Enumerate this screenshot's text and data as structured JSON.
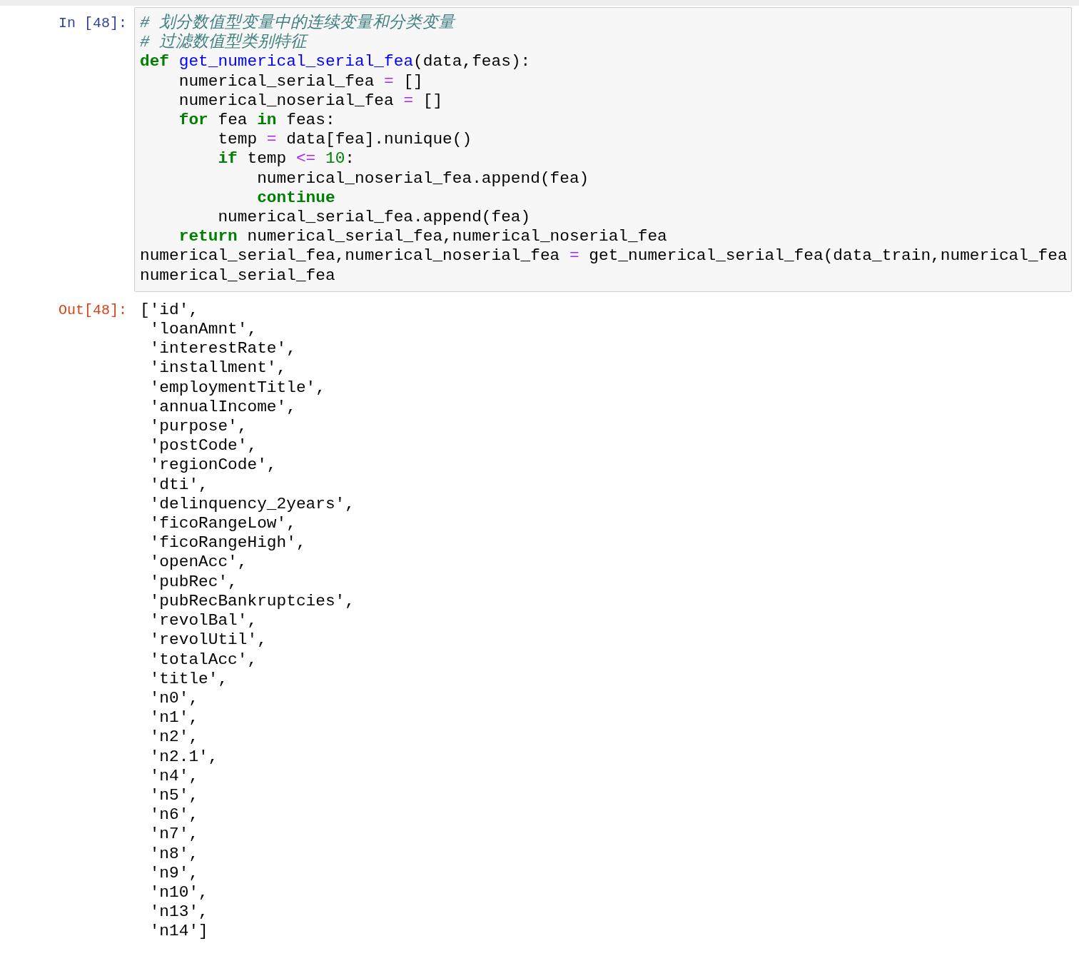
{
  "input_cell": {
    "prompt": "In [48]:",
    "lines": [
      [
        {
          "text": "# 划分数值型变量中的连续变量和分类变量",
          "kind": "comment"
        }
      ],
      [
        {
          "text": "# 过滤数值型类别特征",
          "kind": "comment"
        }
      ],
      [
        {
          "text": "def ",
          "kind": "keyword"
        },
        {
          "text": "get_numerical_serial_fea",
          "kind": "function"
        },
        {
          "text": "(data,feas):",
          "kind": "plain"
        }
      ],
      [
        {
          "text": "    numerical_serial_fea ",
          "kind": "plain"
        },
        {
          "text": "=",
          "kind": "operator"
        },
        {
          "text": " []",
          "kind": "plain"
        }
      ],
      [
        {
          "text": "    numerical_noserial_fea ",
          "kind": "plain"
        },
        {
          "text": "=",
          "kind": "operator"
        },
        {
          "text": " []",
          "kind": "plain"
        }
      ],
      [
        {
          "text": "    for",
          "kind": "keyword"
        },
        {
          "text": " fea ",
          "kind": "plain"
        },
        {
          "text": "in",
          "kind": "keyword"
        },
        {
          "text": " feas:",
          "kind": "plain"
        }
      ],
      [
        {
          "text": "        temp ",
          "kind": "plain"
        },
        {
          "text": "=",
          "kind": "operator"
        },
        {
          "text": " data[fea].nunique()",
          "kind": "plain"
        }
      ],
      [
        {
          "text": "        if",
          "kind": "keyword"
        },
        {
          "text": " temp ",
          "kind": "plain"
        },
        {
          "text": "<=",
          "kind": "operator"
        },
        {
          "text": " 10",
          "kind": "number"
        },
        {
          "text": ":",
          "kind": "plain"
        }
      ],
      [
        {
          "text": "            numerical_noserial_fea.append(fea)",
          "kind": "plain"
        }
      ],
      [
        {
          "text": "            continue",
          "kind": "keyword"
        }
      ],
      [
        {
          "text": "        numerical_serial_fea.append(fea)",
          "kind": "plain"
        }
      ],
      [
        {
          "text": "    return",
          "kind": "keyword"
        },
        {
          "text": " numerical_serial_fea,numerical_noserial_fea",
          "kind": "plain"
        }
      ],
      [
        {
          "text": "numerical_serial_fea,numerical_noserial_fea ",
          "kind": "plain"
        },
        {
          "text": "=",
          "kind": "operator"
        },
        {
          "text": " get_numerical_serial_fea(data_train,numerical_fea",
          "kind": "plain"
        }
      ],
      [
        {
          "text": "numerical_serial_fea",
          "kind": "plain"
        }
      ]
    ]
  },
  "output_cell": {
    "prompt": "Out[48]:",
    "lines": [
      "['id',",
      " 'loanAmnt',",
      " 'interestRate',",
      " 'installment',",
      " 'employmentTitle',",
      " 'annualIncome',",
      " 'purpose',",
      " 'postCode',",
      " 'regionCode',",
      " 'dti',",
      " 'delinquency_2years',",
      " 'ficoRangeLow',",
      " 'ficoRangeHigh',",
      " 'openAcc',",
      " 'pubRec',",
      " 'pubRecBankruptcies',",
      " 'revolBal',",
      " 'revolUtil',",
      " 'totalAcc',",
      " 'title',",
      " 'n0',",
      " 'n1',",
      " 'n2',",
      " 'n2.1',",
      " 'n4',",
      " 'n5',",
      " 'n6',",
      " 'n7',",
      " 'n8',",
      " 'n9',",
      " 'n10',",
      " 'n13',",
      " 'n14']"
    ]
  }
}
